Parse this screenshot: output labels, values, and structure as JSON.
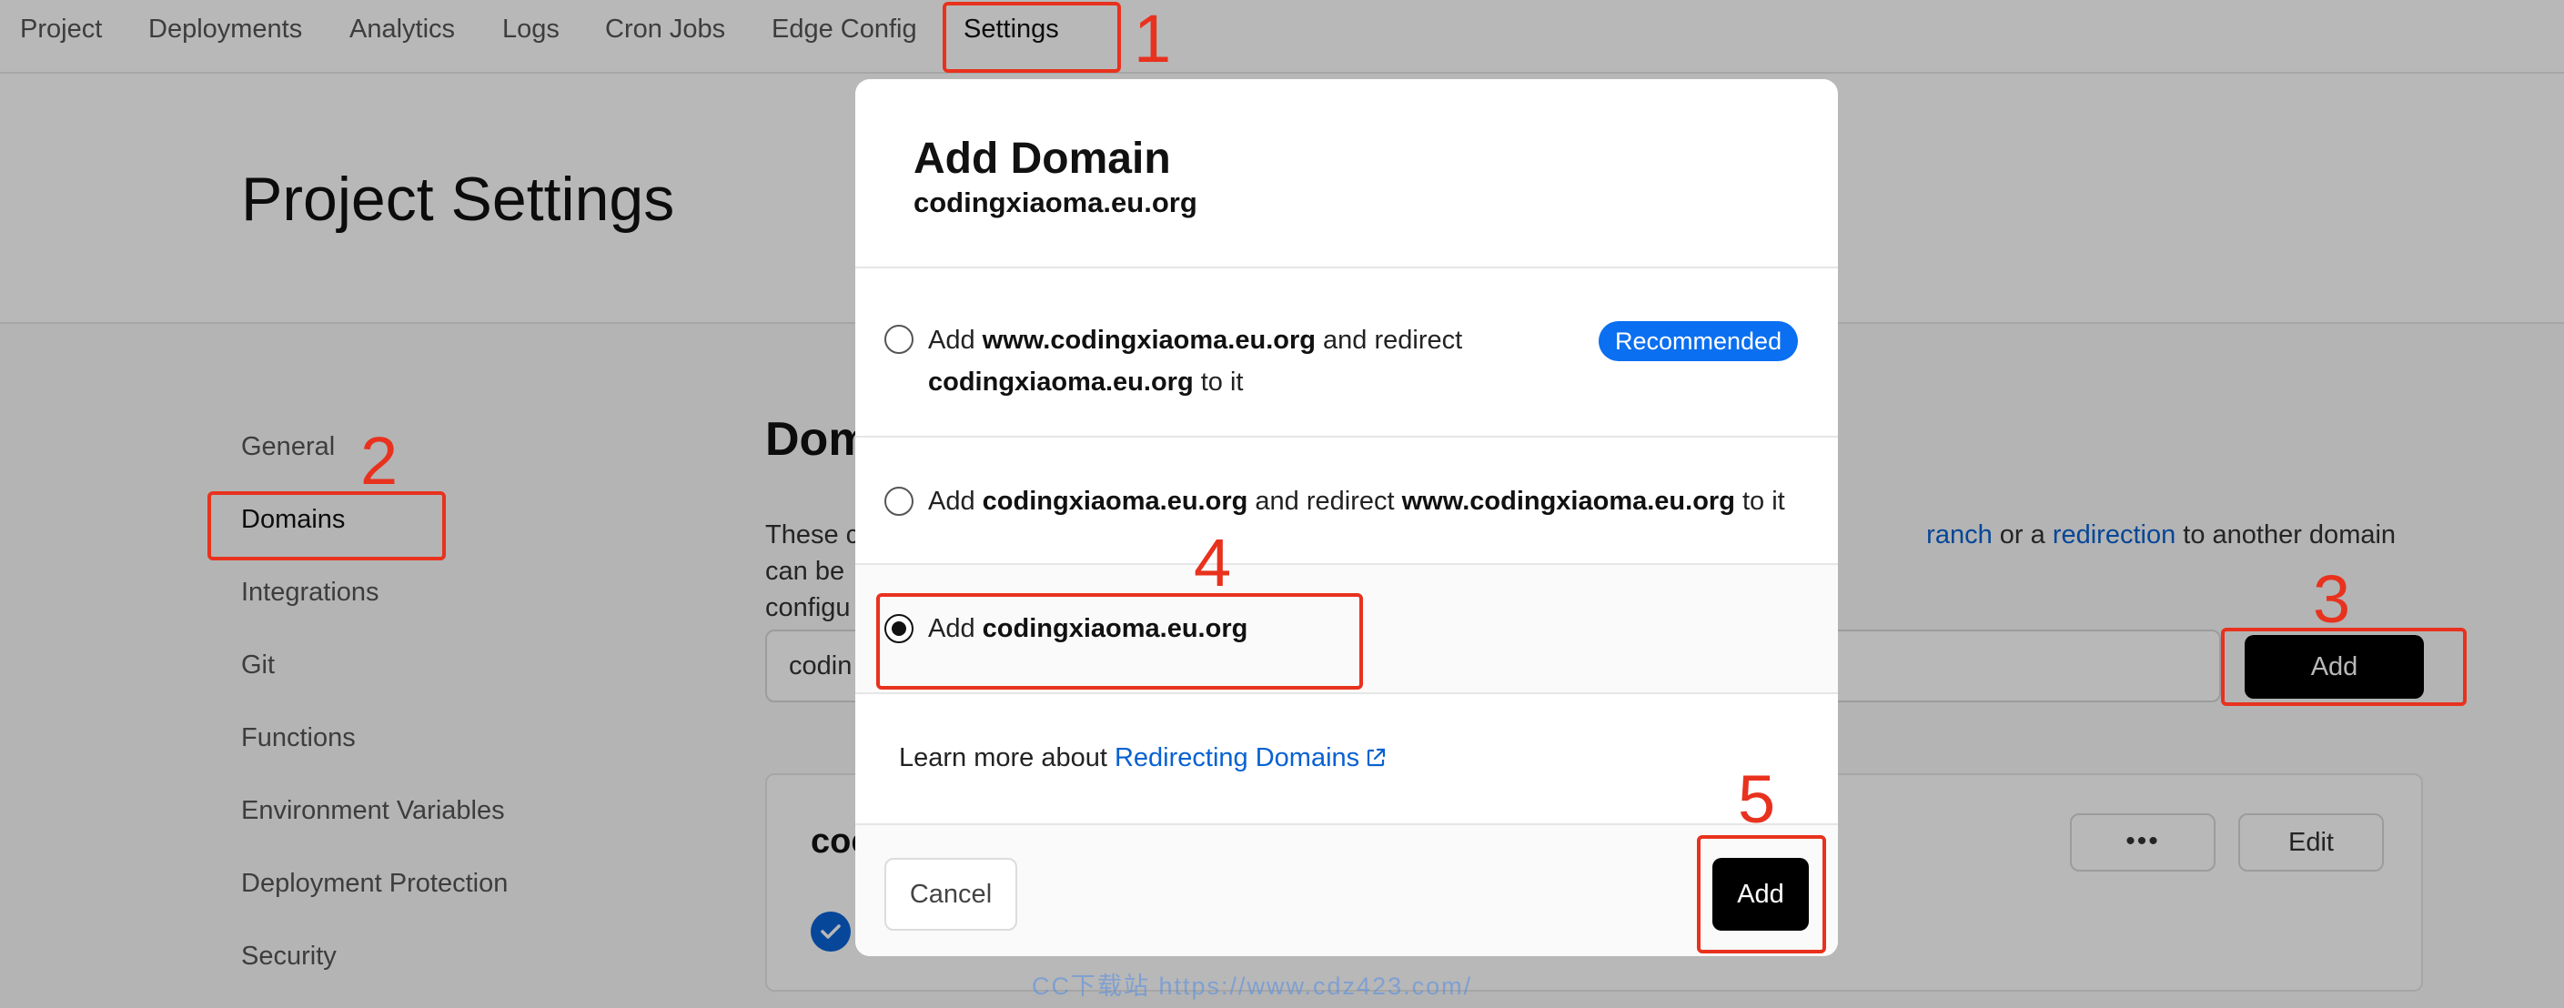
{
  "nav": {
    "tabs": [
      "Project",
      "Deployments",
      "Analytics",
      "Logs",
      "Cron Jobs",
      "Edge Config",
      "Settings"
    ],
    "active": "Settings"
  },
  "page_title": "Project Settings",
  "sidebar": {
    "items": [
      "General",
      "Domains",
      "Integrations",
      "Git",
      "Functions",
      "Environment Variables",
      "Deployment Protection",
      "Security"
    ],
    "active": "Domains"
  },
  "domains_section": {
    "title_visible": "Dom",
    "desc_left_line1": "These c",
    "desc_left_line2": "configu",
    "desc_link1": "ranch",
    "desc_mid": " or a ",
    "desc_link2": "redirection",
    "desc_tail": " to another domain can be",
    "input_value": "codin",
    "add_button": "Add",
    "card_title_visible": "coc",
    "more_button": "•••",
    "edit_button": "Edit"
  },
  "modal": {
    "title": "Add Domain",
    "subtitle": "codingxiaoma.eu.org",
    "options": [
      {
        "pre": "Add ",
        "bold1": "www.codingxiaoma.eu.org",
        "mid": " and redirect",
        "bold2": "codingxiaoma.eu.org",
        "post": " to it",
        "badge": "Recommended",
        "selected": false
      },
      {
        "pre": "Add ",
        "bold1": "codingxiaoma.eu.org",
        "mid": " and redirect ",
        "bold2": "www.codingxiaoma.eu.org",
        "post": " to it",
        "selected": false
      },
      {
        "pre": "Add ",
        "bold1": "codingxiaoma.eu.org",
        "selected": true
      }
    ],
    "learn_more_text": "Learn more about ",
    "learn_more_link": "Redirecting Domains",
    "cancel_button": "Cancel",
    "add_button": "Add"
  },
  "annotations": [
    "1",
    "2",
    "3",
    "4",
    "5"
  ],
  "watermark": "CC下载站  https://www.cdz423.com/",
  "colors": {
    "accent_blue": "#0761d1",
    "badge_blue": "#0a6ff0",
    "annotation_red": "#e8321e",
    "primary_button": "#000000"
  },
  "icons": [
    "external-link-icon",
    "radio-icon",
    "check-circle-icon"
  ]
}
